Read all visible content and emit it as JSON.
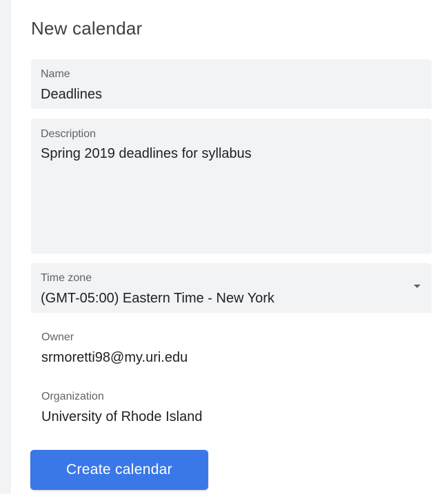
{
  "dialog": {
    "title": "New calendar"
  },
  "fields": {
    "name": {
      "label": "Name",
      "value": "Deadlines"
    },
    "description": {
      "label": "Description",
      "value": "Spring 2019 deadlines for syllabus"
    },
    "time_zone": {
      "label": "Time zone",
      "value": "(GMT-05:00) Eastern Time - New York",
      "icon": "dropdown-arrow-icon"
    }
  },
  "info": {
    "owner": {
      "label": "Owner",
      "value": "srmoretti98@my.uri.edu"
    },
    "organization": {
      "label": "Organization",
      "value": "University of Rhode Island"
    }
  },
  "actions": {
    "create_label": "Create calendar"
  },
  "colors": {
    "accent": "#3b78e7",
    "field_bg": "#f1f3f4",
    "label": "#5f6368",
    "text": "#202124"
  }
}
